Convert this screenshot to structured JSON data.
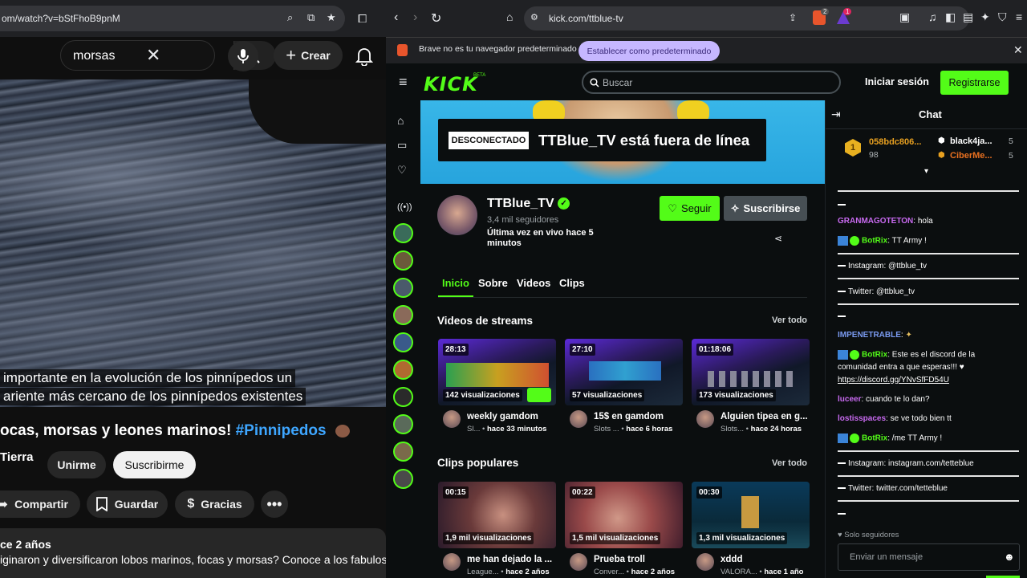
{
  "youtube": {
    "url": "om/watch?v=bStFhoB9pnM",
    "search_query": "morsas",
    "create_label": "Crear",
    "caption_line1": "importante en la evolución de los pinnípedos un",
    "caption_line2": "ariente más cercano de los pinnípedos existentes",
    "title": "ocas, morsas y leones marinos! ",
    "hashtag": "#Pinnipedos",
    "channel": "Tierra",
    "join_label": "Unirme",
    "subscribe_label": "Suscribirme",
    "share_label": "Compartir",
    "save_label": "Guardar",
    "thanks_label": "Gracias",
    "date": "ce 2 años",
    "description": "iginaron y diversificaron lobos marinos, focas y morsas? Conoce a los fabulosos"
  },
  "browser": {
    "url": "kick.com/ttblue-tv",
    "notice": "Brave no es tu navegador predeterminado",
    "set_default": "Establecer como predeterminado",
    "shield_count": "2",
    "alert_count": "1"
  },
  "kick": {
    "logo": "KICK",
    "logo_beta": "BETA",
    "search_placeholder": "Buscar",
    "login": "Iniciar sesión",
    "register": "Registrarse",
    "offline_tag": "DESCONECTADO",
    "offline_text": "TTBlue_TV está fuera de línea",
    "channel_name": "TTBlue_TV",
    "followers": "3,4 mil seguidores",
    "last_live": "Última vez en vivo hace 5 minutos",
    "follow": "Seguir",
    "subscribe": "Suscribirse",
    "tabs": [
      "Inicio",
      "Sobre",
      "Videos",
      "Clips"
    ],
    "streams_heading": "Videos de streams",
    "clips_heading": "Clips populares",
    "see_all": "Ver todo",
    "streams": [
      {
        "duration": "28:13",
        "views": "142 visualizaciones",
        "title": "weekly gamdom",
        "meta": "Sl...",
        "time": "hace 33 minutos"
      },
      {
        "duration": "27:10",
        "views": "57 visualizaciones",
        "title": "15$ en gamdom",
        "meta": "Slots ...",
        "time": "hace 6 horas"
      },
      {
        "duration": "01:18:06",
        "views": "173 visualizaciones",
        "title": "Alguien tipea en g...",
        "meta": "Slots...",
        "time": "hace 24 horas"
      }
    ],
    "clips": [
      {
        "duration": "00:15",
        "views": "1,9 mil visualizaciones",
        "title": "me han dejado la ...",
        "meta": "League...",
        "time": "hace 2 años"
      },
      {
        "duration": "00:22",
        "views": "1,5 mil visualizaciones",
        "title": "Prueba troll",
        "meta": "Conver...",
        "time": "hace 2 años"
      },
      {
        "duration": "00:30",
        "views": "1,3 mil visualizaciones",
        "title": "xddd",
        "meta": "VALORA...",
        "time": "hace 1 año"
      }
    ]
  },
  "chat": {
    "title": "Chat",
    "top1_name": "058bdc806...",
    "top1_count": "98",
    "top2_name": "black4ja...",
    "top2_count": "5",
    "top3_name": "CiberMe...",
    "top3_count": "5",
    "messages": [
      {
        "user": "GRANMAGOTETON",
        "text": "hola"
      },
      {
        "user": "BotRix",
        "text": "TT Army !"
      },
      {
        "user": "",
        "text": "Instagram: @ttblue_tv"
      },
      {
        "user": "",
        "text": "Twitter: @ttblue_tv"
      },
      {
        "user": "IMPENETRABLE",
        "text": ""
      },
      {
        "user": "BotRix",
        "text": "Este es el discord de la"
      },
      {
        "user": "",
        "text": "comunidad entra a que esperas!!! ♥"
      },
      {
        "user": "",
        "text": "https://discord.gg/YNvSfFD54U"
      },
      {
        "user": "luceer",
        "text": "cuando te lo dan?"
      },
      {
        "user": "lostisspaces",
        "text": "se ve todo bien tt"
      },
      {
        "user": "BotRix",
        "text": "/me TT Army !"
      },
      {
        "user": "",
        "text": "Instagram: instagram.com/tetteblue"
      },
      {
        "user": "",
        "text": "Twitter: twitter.com/tetteblue"
      }
    ],
    "followers_only": "Solo seguidores",
    "input_placeholder": "Enviar un mensaje"
  },
  "colors": {
    "kick_green": "#53fc18",
    "yt_bg": "#0f0f0f",
    "kick_bg": "#0b0e0f"
  }
}
